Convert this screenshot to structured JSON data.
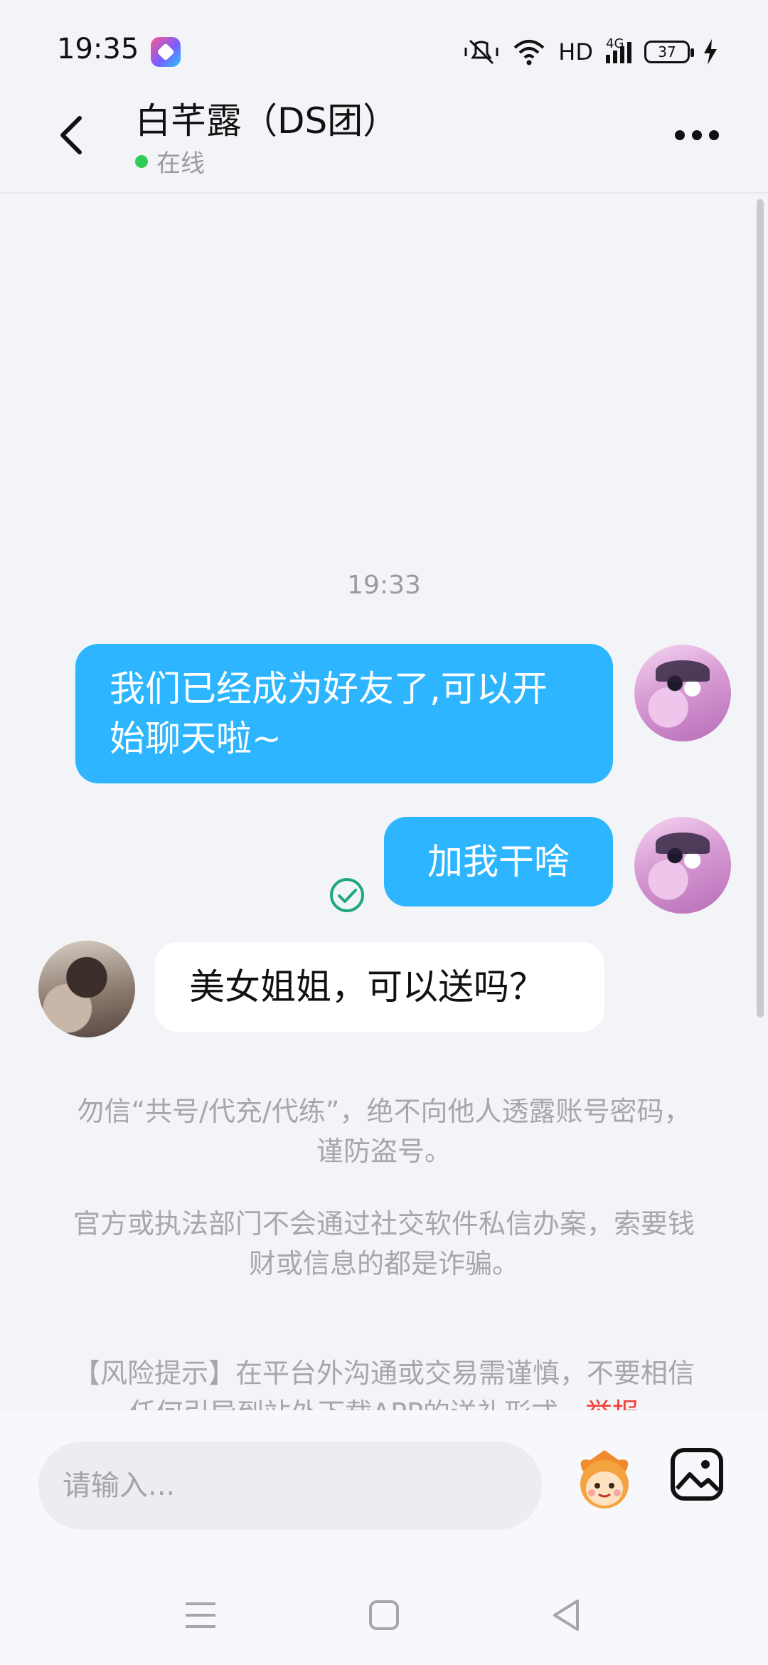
{
  "status_bar": {
    "time": "19:35",
    "network_label": "HD",
    "signal_label": "4G",
    "battery_level": "37",
    "icons": [
      "app-notification-icon",
      "mute-icon",
      "wifi-icon",
      "signal-icon",
      "battery-icon",
      "charging-icon"
    ]
  },
  "header": {
    "title": "白芊露（DS团）",
    "status": "在线",
    "status_color": "#2ecc58",
    "icons": [
      "back-arrow-icon",
      "more-dots-icon"
    ]
  },
  "chat": {
    "timestamp": "19:33",
    "messages": [
      {
        "side": "right",
        "text": "我们已经成为好友了,可以开始聊天啦~"
      },
      {
        "side": "right",
        "text": "加我干啥",
        "read": true
      },
      {
        "side": "left",
        "text": "美女姐姐，可以送吗？"
      }
    ],
    "notices": [
      "勿信“共号/代充/代练”，绝不向他人透露账号密码，谨防盗号。",
      "官方或执法部门不会通过社交软件私信办案，索要钱财或信息的都是诈骗。"
    ],
    "risk_notice": {
      "text": "【风险提示】在平台外沟通或交易需谨慎，不要相信任何引导到站外下载APP的送礼形式，",
      "report_label": "举报"
    },
    "accent_color": "#2db6ff"
  },
  "input_bar": {
    "placeholder": "请输入...",
    "icons": [
      "sticker-mascot-icon",
      "image-picker-icon"
    ]
  },
  "nav_bar": {
    "icons": [
      "menu-lines-icon",
      "home-square-icon",
      "back-triangle-icon"
    ]
  }
}
